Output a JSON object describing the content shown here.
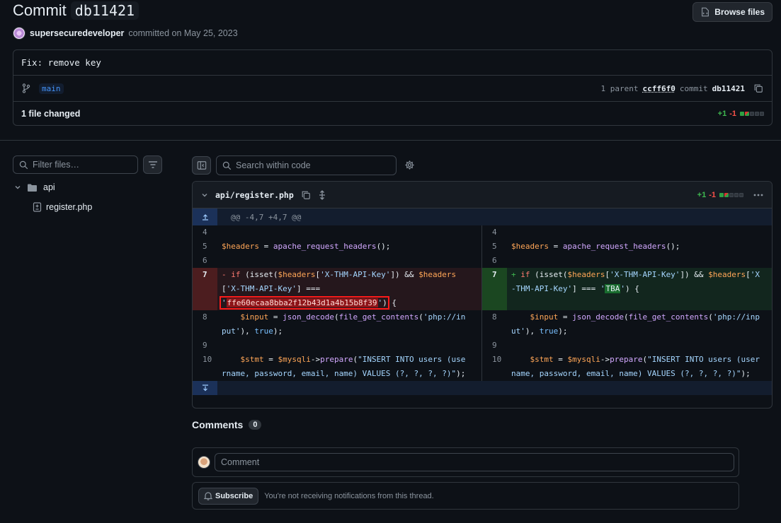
{
  "header": {
    "title": "Commit",
    "sha": "db11421",
    "browse_label": "Browse files",
    "author": "supersecuredeveloper",
    "committed_text": "committed on May 25, 2023"
  },
  "commit": {
    "message": "Fix: remove key",
    "branch": "main",
    "parent_label": "1 parent",
    "parent_sha": "ccff6f0",
    "commit_label": "commit",
    "commit_sha": "db11421",
    "files_changed": "1 file changed",
    "additions": "+1",
    "deletions": "-1"
  },
  "tree": {
    "filter_placeholder": "Filter files…",
    "folder": "api",
    "file": "register.php"
  },
  "toolbar": {
    "search_placeholder": "Search within code"
  },
  "diff": {
    "file_name": "api/register.php",
    "additions": "+1",
    "deletions": "-1",
    "hunk_header": "@@ -4,7 +4,7 @@",
    "line_numbers": [
      "4",
      "5",
      "6",
      "7",
      "8",
      "9",
      "10"
    ],
    "removed_key": "ffe60ecaa8bba2f12b43d1a4b15b8f39",
    "added_value": "TBA"
  },
  "comments": {
    "title": "Comments",
    "count": "0",
    "placeholder": "Comment",
    "subscribe_label": "Subscribe",
    "notification_text": "You're not receiving notifications from this thread."
  },
  "colors": {
    "background": "#0d1117",
    "addition": "#3fb950",
    "deletion": "#f85149",
    "highlight_box": "#ff1a1a"
  }
}
